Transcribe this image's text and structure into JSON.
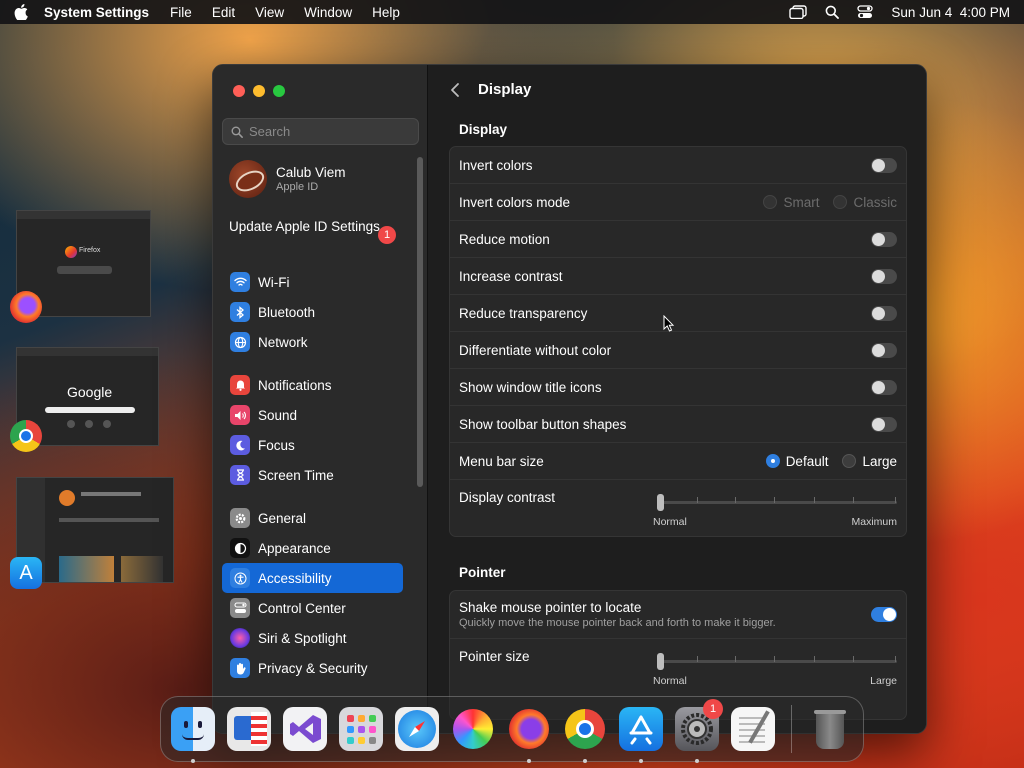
{
  "menubar": {
    "app_name": "System Settings",
    "menus": [
      "File",
      "Edit",
      "View",
      "Window",
      "Help"
    ],
    "datetime": "Sun Jun 4  4:00 PM"
  },
  "sidebar": {
    "search_placeholder": "Search",
    "profile": {
      "name": "Calub Viem",
      "subtitle": "Apple ID"
    },
    "update": {
      "label": "Update Apple ID Settings",
      "badge": "1"
    },
    "groups": [
      [
        {
          "label": "Wi-Fi",
          "icon": "wifi-icon",
          "color": "#2f7fe0"
        },
        {
          "label": "Bluetooth",
          "icon": "bluetooth-icon",
          "color": "#2f7fe0"
        },
        {
          "label": "Network",
          "icon": "globe-icon",
          "color": "#2f7fe0"
        }
      ],
      [
        {
          "label": "Notifications",
          "icon": "bell-icon",
          "color": "#e8453c"
        },
        {
          "label": "Sound",
          "icon": "speaker-icon",
          "color": "#e8456a"
        },
        {
          "label": "Focus",
          "icon": "moon-icon",
          "color": "#5c5ce0"
        },
        {
          "label": "Screen Time",
          "icon": "hourglass-icon",
          "color": "#5c5ce0"
        }
      ],
      [
        {
          "label": "General",
          "icon": "gear-icon",
          "color": "#8a8a8a"
        },
        {
          "label": "Appearance",
          "icon": "appearance-icon",
          "color": "#111111"
        },
        {
          "label": "Accessibility",
          "icon": "accessibility-icon",
          "color": "#2f7fe0",
          "active": true
        },
        {
          "label": "Control Center",
          "icon": "control-center-icon",
          "color": "#8a8a8a"
        },
        {
          "label": "Siri & Spotlight",
          "icon": "siri-icon",
          "color": "#b04ad0"
        },
        {
          "label": "Privacy & Security",
          "icon": "hand-icon",
          "color": "#2f7fe0"
        }
      ]
    ]
  },
  "content": {
    "back_icon": "chevron-left-icon",
    "title": "Display",
    "display_section": {
      "title": "Display",
      "rows": [
        {
          "label": "Invert colors",
          "type": "toggle",
          "on": false
        },
        {
          "label": "Invert colors mode",
          "type": "radio",
          "options": [
            "Smart",
            "Classic"
          ],
          "selected": null,
          "disabled": true
        },
        {
          "label": "Reduce motion",
          "type": "toggle",
          "on": false
        },
        {
          "label": "Increase contrast",
          "type": "toggle",
          "on": false
        },
        {
          "label": "Reduce transparency",
          "type": "toggle",
          "on": false
        },
        {
          "label": "Differentiate without color",
          "type": "toggle",
          "on": false
        },
        {
          "label": "Show window title icons",
          "type": "toggle",
          "on": false
        },
        {
          "label": "Show toolbar button shapes",
          "type": "toggle",
          "on": false
        },
        {
          "label": "Menu bar size",
          "type": "radio",
          "options": [
            "Default",
            "Large"
          ],
          "selected": 0
        },
        {
          "label": "Display contrast",
          "type": "slider",
          "min_label": "Normal",
          "max_label": "Maximum",
          "value": 0
        }
      ]
    },
    "pointer_section": {
      "title": "Pointer",
      "rows": [
        {
          "label": "Shake mouse pointer to locate",
          "sub": "Quickly move the mouse pointer back and forth to make it bigger.",
          "type": "toggle",
          "on": true
        },
        {
          "label": "Pointer size",
          "type": "slider",
          "min_label": "Normal",
          "max_label": "Large",
          "value": 0
        }
      ]
    }
  },
  "desktop_thumbnails": [
    {
      "app": "Firefox",
      "text": "Firefox"
    },
    {
      "app": "Chrome",
      "text": "Google"
    },
    {
      "app": "App Store",
      "text": ""
    }
  ],
  "dock": [
    {
      "name": "Finder",
      "icon": "finder-icon",
      "running": true
    },
    {
      "name": "Screenshot Utility",
      "icon": "screenshot-icon",
      "running": false
    },
    {
      "name": "Visual Studio",
      "icon": "visual-studio-icon",
      "running": false
    },
    {
      "name": "Launchpad",
      "icon": "launchpad-icon",
      "running": false
    },
    {
      "name": "Safari",
      "icon": "safari-icon",
      "running": false
    },
    {
      "name": "Color Picker",
      "icon": "color-wheel-icon",
      "running": false
    },
    {
      "name": "Firefox",
      "icon": "firefox-icon",
      "running": true
    },
    {
      "name": "Google Chrome",
      "icon": "chrome-icon",
      "running": true
    },
    {
      "name": "App Store",
      "icon": "app-store-icon",
      "running": true
    },
    {
      "name": "System Settings",
      "icon": "system-settings-icon",
      "running": true,
      "badge": "1"
    },
    {
      "name": "TextEdit",
      "icon": "textedit-icon",
      "running": false
    },
    {
      "name": "Trash",
      "icon": "trash-icon",
      "running": false
    }
  ]
}
